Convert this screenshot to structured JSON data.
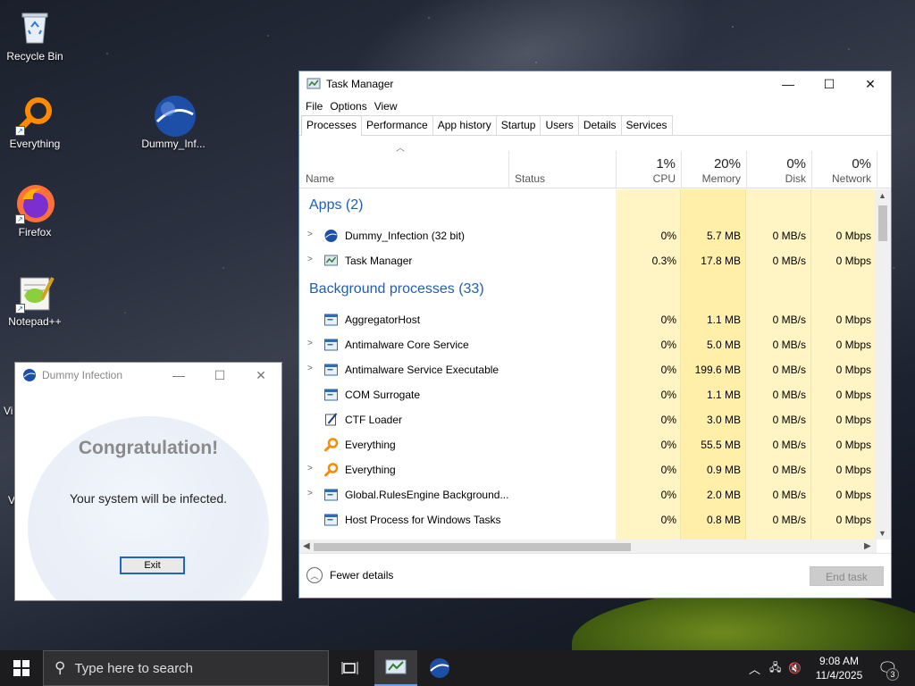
{
  "desktop": {
    "icons": [
      {
        "label": "Recycle Bin"
      },
      {
        "label": "Everything"
      },
      {
        "label": "Dummy_Inf..."
      },
      {
        "label": "Firefox"
      },
      {
        "label": "Notepad++"
      }
    ],
    "partial_labels": [
      "Vi",
      "V"
    ]
  },
  "dummy_window": {
    "title": "Dummy Infection",
    "heading": "Congratulation!",
    "message": "Your system will be infected.",
    "exit_label": "Exit"
  },
  "task_manager": {
    "title": "Task Manager",
    "menu": [
      "File",
      "Options",
      "View"
    ],
    "tabs": [
      "Processes",
      "Performance",
      "App history",
      "Startup",
      "Users",
      "Details",
      "Services"
    ],
    "active_tab": "Processes",
    "columns": {
      "name": "Name",
      "status": "Status",
      "cpu": {
        "pct": "1%",
        "label": "CPU"
      },
      "memory": {
        "pct": "20%",
        "label": "Memory"
      },
      "disk": {
        "pct": "0%",
        "label": "Disk"
      },
      "network": {
        "pct": "0%",
        "label": "Network"
      }
    },
    "groups": {
      "apps": "Apps (2)",
      "background": "Background processes (33)"
    },
    "apps": [
      {
        "name": "Dummy_Infection (32 bit)",
        "cpu": "0%",
        "memory": "5.7 MB",
        "disk": "0 MB/s",
        "network": "0 Mbps"
      },
      {
        "name": "Task Manager",
        "cpu": "0.3%",
        "memory": "17.8 MB",
        "disk": "0 MB/s",
        "network": "0 Mbps"
      }
    ],
    "background": [
      {
        "name": "AggregatorHost",
        "cpu": "0%",
        "memory": "1.1 MB",
        "disk": "0 MB/s",
        "network": "0 Mbps"
      },
      {
        "name": "Antimalware Core Service",
        "cpu": "0%",
        "memory": "5.0 MB",
        "disk": "0 MB/s",
        "network": "0 Mbps"
      },
      {
        "name": "Antimalware Service Executable",
        "cpu": "0%",
        "memory": "199.6 MB",
        "disk": "0 MB/s",
        "network": "0 Mbps"
      },
      {
        "name": "COM Surrogate",
        "cpu": "0%",
        "memory": "1.1 MB",
        "disk": "0 MB/s",
        "network": "0 Mbps"
      },
      {
        "name": "CTF Loader",
        "cpu": "0%",
        "memory": "3.0 MB",
        "disk": "0 MB/s",
        "network": "0 Mbps"
      },
      {
        "name": "Everything",
        "cpu": "0%",
        "memory": "55.5 MB",
        "disk": "0 MB/s",
        "network": "0 Mbps"
      },
      {
        "name": "Everything",
        "cpu": "0%",
        "memory": "0.9 MB",
        "disk": "0 MB/s",
        "network": "0 Mbps"
      },
      {
        "name": "Global.RulesEngine Background...",
        "cpu": "0%",
        "memory": "2.0 MB",
        "disk": "0 MB/s",
        "network": "0 Mbps"
      },
      {
        "name": "Host Process for Windows Tasks",
        "cpu": "0%",
        "memory": "0.8 MB",
        "disk": "0 MB/s",
        "network": "0 Mbps"
      }
    ],
    "fewer_details": "Fewer details",
    "end_task": "End task"
  },
  "taskbar": {
    "search_placeholder": "Type here to search",
    "time": "9:08 AM",
    "date": "11/4/2025",
    "notification_count": "3"
  },
  "colors": {
    "accent": "#1e5fb4",
    "cpu_heat": "#fff4c4",
    "mem_heat": "#ffefa9",
    "taskbar": "#1c1c1e"
  }
}
